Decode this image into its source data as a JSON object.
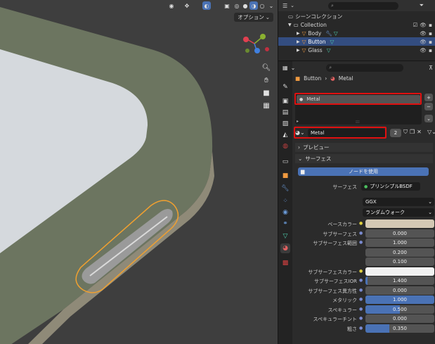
{
  "viewport": {
    "options_label": "オプション"
  },
  "outliner": {
    "scene_collection": "シーンコレクション",
    "collection": "Collection",
    "items": [
      {
        "name": "Body"
      },
      {
        "name": "Button"
      },
      {
        "name": "Glass"
      }
    ]
  },
  "properties": {
    "breadcrumb": {
      "object": "Button",
      "material": "Metal"
    },
    "material_slot": "Metal",
    "material_name": "Metal",
    "user_count": "2",
    "preview_label": "プレビュー",
    "surface_label": "サーフェス",
    "use_nodes_label": "ノードを使用",
    "surface_row": {
      "label": "サーフェス",
      "value": "プリンシプルBSDF"
    },
    "distribution": "GGX",
    "subsurface_method": "ランダムウォーク",
    "rows": [
      {
        "label": "ベースカラー",
        "value": "",
        "kind": "color",
        "color": "#d4c8b4"
      },
      {
        "label": "サブサーフェス",
        "value": "0.000",
        "kind": "num"
      },
      {
        "label": "サブサーフェス範囲",
        "value": "1.000",
        "kind": "num"
      },
      {
        "label": "",
        "value": "0.200",
        "kind": "num"
      },
      {
        "label": "",
        "value": "0.100",
        "kind": "num"
      },
      {
        "label": "サブサーフェスカラー",
        "value": "",
        "kind": "color",
        "color": "#f2f2f2"
      },
      {
        "label": "サブサーフェスIOR",
        "value": "1.400",
        "kind": "slider",
        "fill": 0.03
      },
      {
        "label": "サブサーフェス異方性",
        "value": "0.000",
        "kind": "num"
      },
      {
        "label": "メタリック",
        "value": "1.000",
        "kind": "slider",
        "fill": 1.0
      },
      {
        "label": "スペキュラー",
        "value": "0.500",
        "kind": "slider",
        "fill": 0.5
      },
      {
        "label": "スペキュラーチント",
        "value": "0.000",
        "kind": "num"
      },
      {
        "label": "粗さ",
        "value": "0.350",
        "kind": "slider",
        "fill": 0.35
      }
    ]
  },
  "colors": {
    "accent": "#4a72b5",
    "selection": "#334d80",
    "highlight": "#e01010",
    "outline": "#f0a030"
  }
}
